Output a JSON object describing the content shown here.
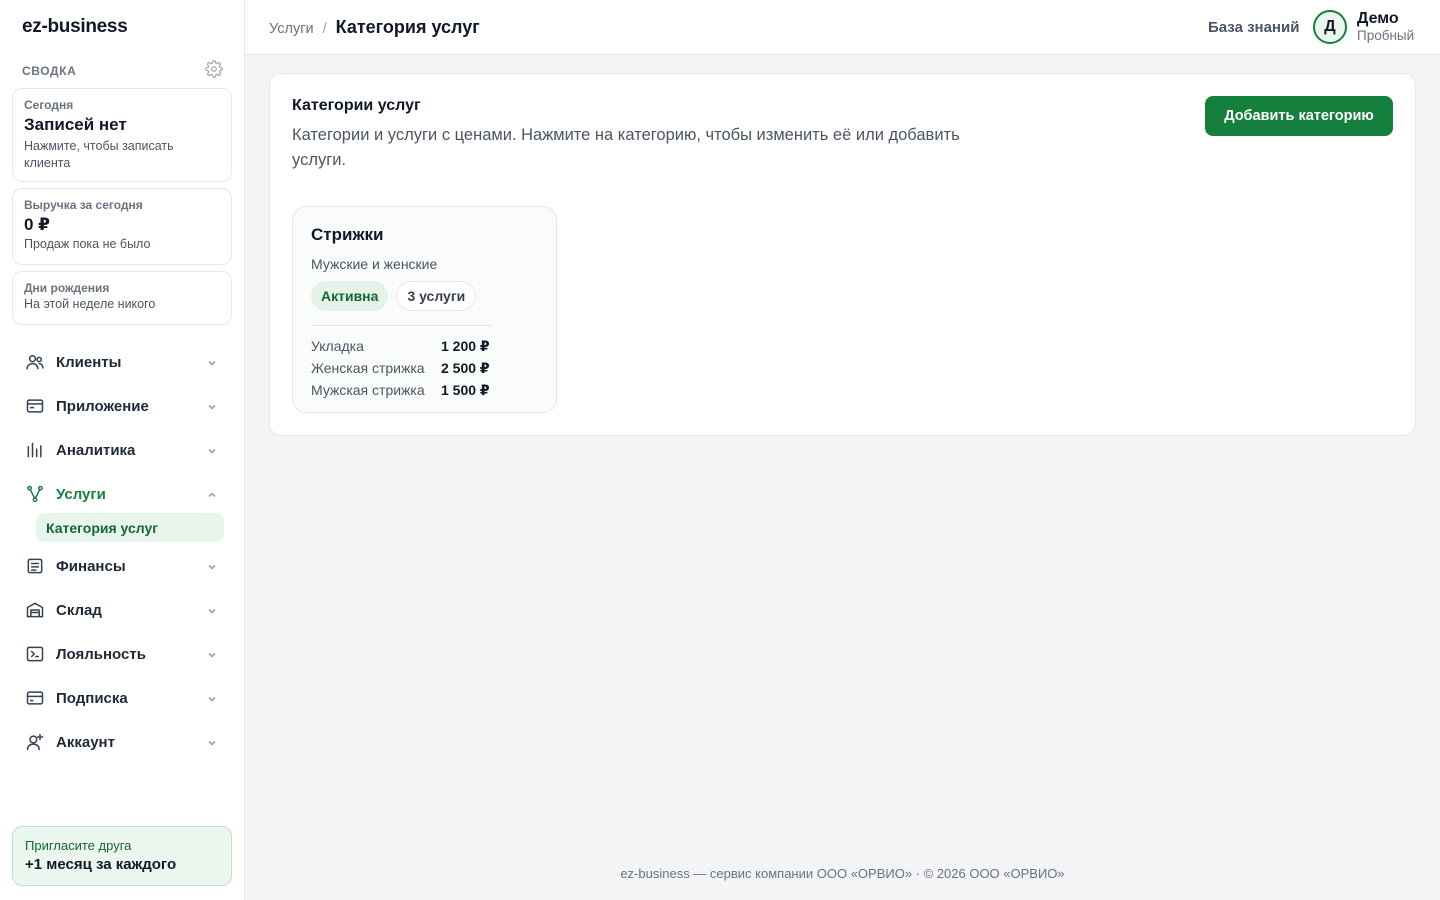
{
  "app": {
    "logo": "ez-business"
  },
  "sidebar": {
    "summary_title": "СВОДКА",
    "cards": {
      "today": {
        "label": "Сегодня",
        "value": "Записей нет",
        "hint": "Нажмите, чтобы записать клиента"
      },
      "revenue": {
        "label": "Выручка за сегодня",
        "value": "0 ₽",
        "hint": "Продаж пока не было"
      },
      "birthdays": {
        "label": "Дни рождения",
        "hint": "На этой неделе никого"
      }
    },
    "nav": [
      {
        "label": "Клиенты",
        "icon": "users-icon"
      },
      {
        "label": "Приложение",
        "icon": "app-window-icon"
      },
      {
        "label": "Аналитика",
        "icon": "bar-chart-icon"
      },
      {
        "label": "Услуги",
        "icon": "services-icon",
        "expanded": true,
        "active": true
      },
      {
        "label": "Финансы",
        "icon": "document-icon"
      },
      {
        "label": "Склад",
        "icon": "warehouse-icon"
      },
      {
        "label": "Лояльность",
        "icon": "loyalty-icon"
      },
      {
        "label": "Подписка",
        "icon": "credit-card-icon"
      },
      {
        "label": "Аккаунт",
        "icon": "user-plus-icon"
      }
    ],
    "sub_item": "Категория услуг",
    "invite": {
      "line1": "Пригласите друга",
      "line2": "+1 месяц за каждого"
    }
  },
  "header": {
    "breadcrumb_parent": "Услуги",
    "breadcrumb_sep": "/",
    "breadcrumb_current": "Категория услуг",
    "knowledge_base": "База знаний",
    "avatar_letter": "Д",
    "user_name": "Демо",
    "user_plan": "Пробный"
  },
  "main": {
    "title": "Категории услуг",
    "description": "Категории и услуги с ценами. Нажмите на категорию, чтобы изменить её или добавить услуги.",
    "add_button": "Добавить категорию",
    "categories": [
      {
        "name": "Стрижки",
        "description": "Мужские и женские",
        "status": "Активна",
        "count": "3 услуги",
        "services": [
          {
            "name": "Укладка",
            "price": "1 200 ₽"
          },
          {
            "name": "Женская стрижка",
            "price": "2 500 ₽"
          },
          {
            "name": "Мужская стрижка",
            "price": "1 500 ₽"
          }
        ]
      }
    ]
  },
  "footer": {
    "text": "ez-business — сервис компании ООО «ОРВИО» · © 2026 ООО «ОРВИО»"
  },
  "colors": {
    "accent": "#15803d",
    "accent_light": "#e8f5ec",
    "background": "#f3f4f6"
  }
}
